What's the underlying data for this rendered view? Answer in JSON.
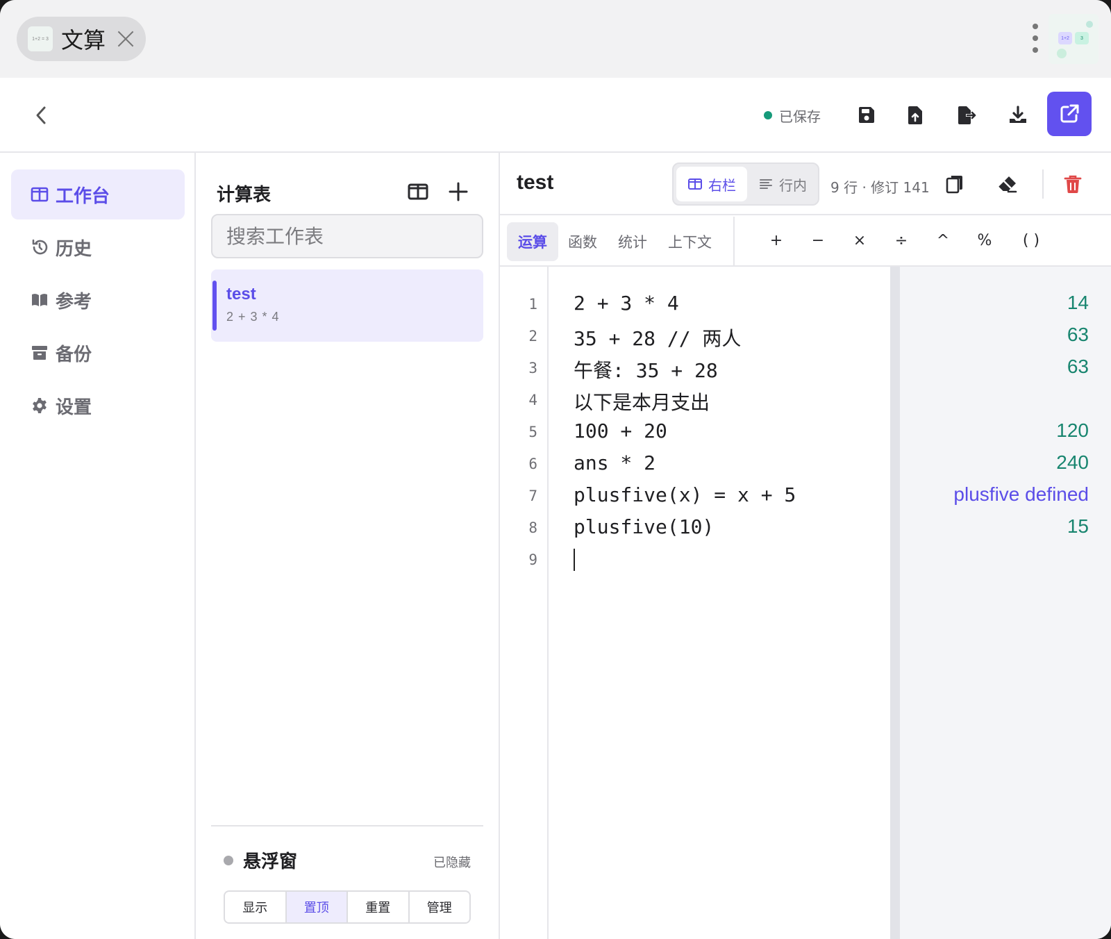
{
  "titlebar": {
    "app_name": "文算",
    "logo_text": "1+2 = 3",
    "widget_a": "1+2",
    "widget_b": "3"
  },
  "toolbar": {
    "saved_status": "已保存",
    "icons": [
      "back-chevron-icon",
      "save-icon",
      "file-upload-icon",
      "file-export-icon",
      "download-icon",
      "external-link-icon"
    ],
    "accent": "#6251ef"
  },
  "sidebar": {
    "items": [
      {
        "label": "工作台",
        "icon": "columns-icon",
        "active": true
      },
      {
        "label": "历史",
        "icon": "history-icon",
        "active": false
      },
      {
        "label": "参考",
        "icon": "book-icon",
        "active": false
      },
      {
        "label": "备份",
        "icon": "archive-icon",
        "active": false
      },
      {
        "label": "设置",
        "icon": "gear-icon",
        "active": false
      }
    ]
  },
  "sheets": {
    "title": "计算表",
    "search_placeholder": "搜索工作表",
    "items": [
      {
        "name": "test",
        "preview": "2 + 3 * 4",
        "active": true
      }
    ],
    "floating": {
      "title": "悬浮窗",
      "status": "已隐藏",
      "buttons": [
        "显示",
        "置顶",
        "重置",
        "管理"
      ],
      "active_button": "置顶"
    }
  },
  "editor": {
    "title": "test",
    "modes": [
      "右栏",
      "行内"
    ],
    "active_mode": "右栏",
    "meta": "9 行 · 修订 141",
    "op_tabs": [
      "运算",
      "函数",
      "统计",
      "上下文"
    ],
    "active_op_tab": "运算",
    "symbols": [
      "+",
      "−",
      "×",
      "÷",
      "^",
      "%",
      "( )"
    ],
    "lines": [
      {
        "n": "1",
        "code": "2 + 3 * 4",
        "result": "14"
      },
      {
        "n": "2",
        "code": "35 + 28 // 两人",
        "result": "63"
      },
      {
        "n": "3",
        "code": "午餐: 35 + 28",
        "result": "63"
      },
      {
        "n": "4",
        "code": "以下是本月支出",
        "result": ""
      },
      {
        "n": "5",
        "code": "100 + 20",
        "result": "120"
      },
      {
        "n": "6",
        "code": "ans * 2",
        "result": "240"
      },
      {
        "n": "7",
        "code": "plusfive(x) = x + 5",
        "result": "plusfive defined"
      },
      {
        "n": "8",
        "code": "plusfive(10)",
        "result": "15"
      },
      {
        "n": "9",
        "code": "",
        "result": ""
      }
    ],
    "result_color": "#18856f",
    "defined_color": "#5b4de8",
    "delete_color": "#e04848"
  }
}
